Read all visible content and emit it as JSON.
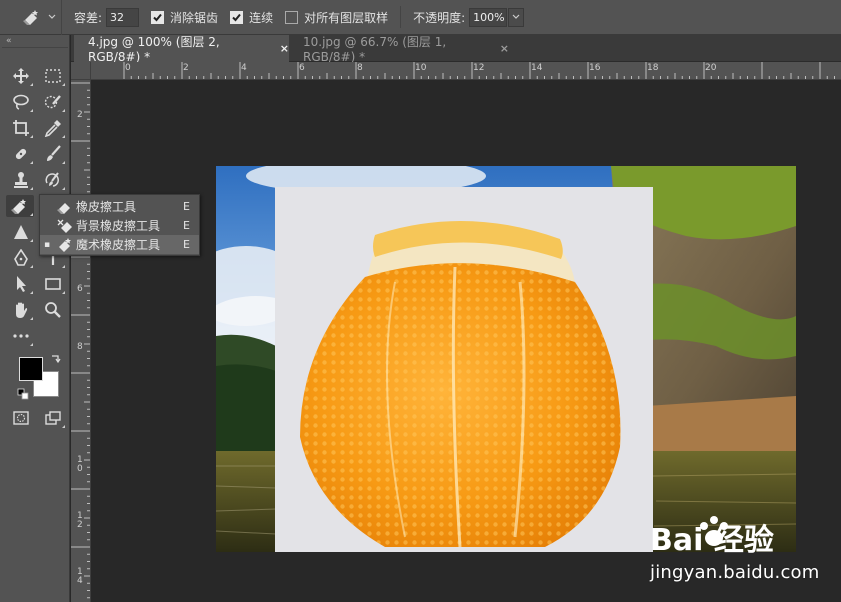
{
  "options_bar": {
    "tolerance_label": "容差:",
    "tolerance_value": "32",
    "antialias_label": "消除锯齿",
    "antialias_checked": true,
    "contiguous_label": "连续",
    "contiguous_checked": true,
    "sample_all_layers_label": "对所有图层取样",
    "sample_all_layers_checked": false,
    "opacity_label": "不透明度:",
    "opacity_value": "100%"
  },
  "tabs": [
    {
      "label": "4.jpg @ 100% (图层 2, RGB/8#) *",
      "close": "×",
      "active": true
    },
    {
      "label": "10.jpg @ 66.7% (图层 1, RGB/8#) *",
      "close": "×",
      "active": false
    }
  ],
  "flyout": {
    "items": [
      {
        "label": "橡皮擦工具",
        "shortcut": "E",
        "selected": false
      },
      {
        "label": "背景橡皮擦工具",
        "shortcut": "E",
        "selected": false
      },
      {
        "label": "魔术橡皮擦工具",
        "shortcut": "E",
        "selected": true,
        "marker": "▪"
      }
    ]
  },
  "ruler_top": [
    "0",
    "2",
    "4",
    "6",
    "8",
    "10",
    "12",
    "14",
    "16",
    "18",
    "20"
  ],
  "ruler_left": [
    "2",
    "4",
    "6",
    "8",
    "1 0",
    "1 2",
    "1 4"
  ],
  "toolbar": {
    "collapse_glyph": "«"
  },
  "watermark": {
    "brand": "Bai 经验",
    "url": "jingyan.baidu.com"
  },
  "colors": {
    "foreground": "#000000",
    "background": "#ffffff",
    "ui_panel": "#535353",
    "canvas_bg": "#282828"
  }
}
